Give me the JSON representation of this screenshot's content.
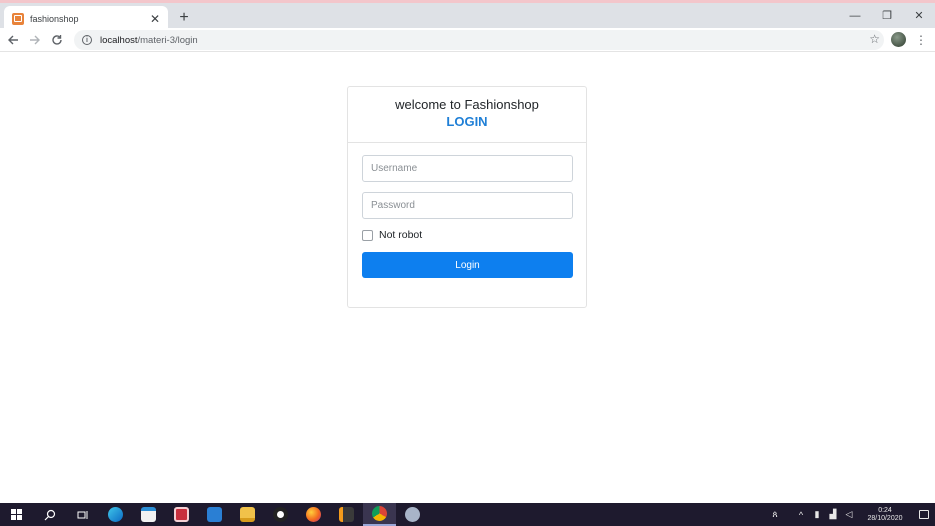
{
  "browser": {
    "tab_title": "fashionshop",
    "tab_close": "✕",
    "new_tab": "+",
    "url_host": "localhost",
    "url_path": "/materi-3/login",
    "minimize": "—",
    "restore": "❐",
    "close": "✕"
  },
  "login": {
    "welcome": "welcome to Fashionshop",
    "title": "LOGIN",
    "username_placeholder": "Username",
    "password_placeholder": "Password",
    "checkbox_label": "Not robot",
    "button_label": "Login"
  },
  "taskbar": {
    "time": "0:24",
    "date": "28/10/2020"
  },
  "colors": {
    "accent": "#0d7fef",
    "title_blue": "#1f7fd6"
  }
}
